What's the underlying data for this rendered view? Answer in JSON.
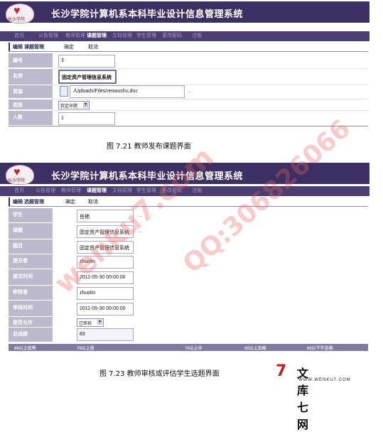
{
  "app_title": "长沙学院计算机系本科毕业设计信息管理系统",
  "logo_text": "长沙学院",
  "nav": [
    "首页",
    "公告管理",
    "教师管理",
    "课题管理",
    "文档管理",
    "学生管理",
    "更改密码",
    "注销"
  ],
  "nav_active": "课题管理",
  "screen1": {
    "breadcrumb": "编辑  课题管理",
    "actions": [
      "确定",
      "取消"
    ],
    "fields": [
      {
        "label": "编号",
        "value": "3"
      },
      {
        "label": "名称",
        "value": "固定资产管理信息系统"
      },
      {
        "label": "资源",
        "value": "./Uploads/Files/renwushu.doc",
        "extra": "..."
      },
      {
        "label": "类型",
        "value": "我定命题"
      },
      {
        "label": "人数",
        "value": "1"
      }
    ],
    "caption": "图 7.21   教师发布课题界面"
  },
  "screen2": {
    "breadcrumb": "编辑 选题管理",
    "actions": [
      "确定",
      "取消"
    ],
    "fields": [
      {
        "label": "学生",
        "value": "岳艳",
        "extra": "..."
      },
      {
        "label": "课题",
        "value": "固定资产管理信息系统",
        "extra": "..."
      },
      {
        "label": "题目",
        "value": "固定资产管理信息系统"
      },
      {
        "label": "提交者",
        "value": "zhuolin"
      },
      {
        "label": "提交时间",
        "value": "2011-05-30 00:00:00"
      },
      {
        "label": "审核者",
        "value": "zhuolin"
      },
      {
        "label": "审核时间",
        "value": "2011-05-30 00:00:00"
      },
      {
        "label": "是否允许",
        "value": "已审核"
      },
      {
        "label": "总成绩",
        "value": "83"
      }
    ],
    "grades": [
      "89以上优秀",
      "79以上良",
      "70以上中",
      "60以上及格",
      "60以下不及格"
    ],
    "caption": "图 7.23   教师审核或评估学生选题界面"
  },
  "watermarks": [
    "wenku7.com",
    "QQ:306826066"
  ],
  "brand": {
    "mark": "7",
    "name": "文库七网",
    "url": "WWW.WENKU7.COM"
  }
}
